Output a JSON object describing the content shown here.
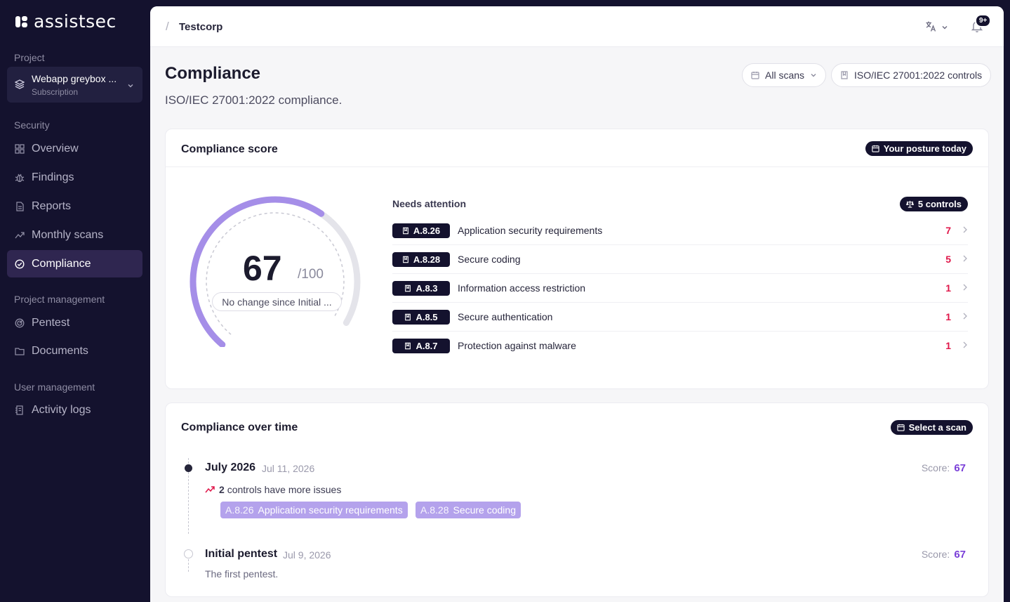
{
  "app": {
    "name": "assistsec"
  },
  "sidebar": {
    "project_label": "Project",
    "project_name": "Webapp greybox ...",
    "project_sub": "Subscription",
    "security_label": "Security",
    "items": [
      {
        "label": "Overview",
        "icon": "grid-icon"
      },
      {
        "label": "Findings",
        "icon": "bug-icon"
      },
      {
        "label": "Reports",
        "icon": "document-icon"
      },
      {
        "label": "Monthly scans",
        "icon": "trend-icon"
      },
      {
        "label": "Compliance",
        "icon": "check-circle-icon",
        "active": true
      }
    ],
    "pm_label": "Project management",
    "pm_items": [
      {
        "label": "Pentest",
        "icon": "radar-icon"
      },
      {
        "label": "Documents",
        "icon": "folder-icon"
      }
    ],
    "um_label": "User management",
    "um_items": [
      {
        "label": "Activity logs",
        "icon": "log-icon"
      }
    ]
  },
  "topbar": {
    "separator": "/",
    "org": "Testcorp",
    "notifications_badge": "9+"
  },
  "page": {
    "title": "Compliance",
    "subtitle": "ISO/IEC 27001:2022 compliance.",
    "scan_filter": "All scans",
    "framework_filter": "ISO/IEC 27001:2022 controls"
  },
  "score_card": {
    "title": "Compliance score",
    "badge": "Your posture today",
    "score": "67",
    "score_max": "/100",
    "score_fraction": 0.67,
    "change_text": "No change since Initial ...",
    "needs_attention": "Needs attention",
    "controls_badge": "5 controls",
    "controls": [
      {
        "code": "A.8.26",
        "name": "Application security requirements",
        "count": "7"
      },
      {
        "code": "A.8.28",
        "name": "Secure coding",
        "count": "5"
      },
      {
        "code": "A.8.3",
        "name": "Information access restriction",
        "count": "1"
      },
      {
        "code": "A.8.5",
        "name": "Secure authentication",
        "count": "1"
      },
      {
        "code": "A.8.7",
        "name": "Protection against malware",
        "count": "1"
      }
    ]
  },
  "timeline_card": {
    "title": "Compliance over time",
    "badge": "Select a scan",
    "entries": [
      {
        "title": "July 2026",
        "date": "Jul 11, 2026",
        "score_label": "Score:",
        "score": "67",
        "change_count": "2",
        "change_text": "controls have more issues",
        "tags": [
          {
            "code": "A.8.26",
            "name": "Application security requirements"
          },
          {
            "code": "A.8.28",
            "name": "Secure coding"
          }
        ]
      },
      {
        "title": "Initial pentest",
        "date": "Jul 9, 2026",
        "score_label": "Score:",
        "score": "67",
        "description": "The first pentest."
      }
    ]
  },
  "colors": {
    "accent": "#a58ee8",
    "danger": "#e0174a",
    "dark": "#14122e"
  }
}
